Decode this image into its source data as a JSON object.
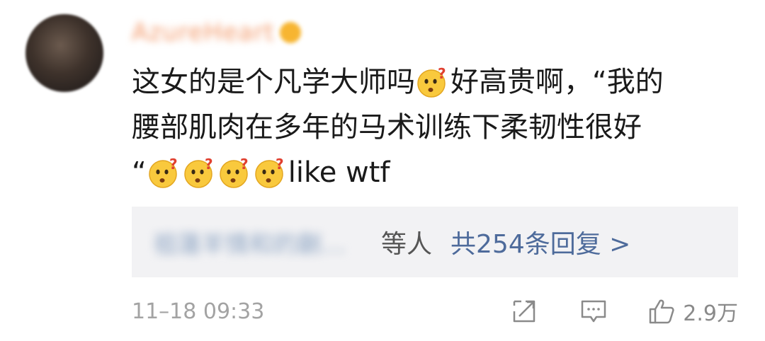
{
  "comment": {
    "username": "AzureHeart",
    "body_lines": [
      [
        "这女的是个凡学大师吗",
        "emoji",
        "好高贵啊，“我的"
      ],
      [
        "腰部肌肉在多年的马术训练下柔韧性很好"
      ],
      [
        "“",
        "emoji",
        "emoji",
        "emoji",
        "emoji",
        "like wtf"
      ]
    ],
    "emoji_icon": "confused-face-emoji-icon"
  },
  "replies": {
    "blurred_names": "祖蓮羊情和的蒯…",
    "others_text": "等人",
    "count_text": "共254条回复 >"
  },
  "footer": {
    "timestamp": "11–18 09:33",
    "share_icon": "share-icon",
    "comment_icon": "comment-icon",
    "like_icon": "thumbs-up-icon",
    "like_count": "2.9万"
  },
  "colors": {
    "link": "#4e6b9b",
    "text": "#1a1a1a",
    "meta": "#a3a3a3",
    "reply_box_bg": "#f2f2f4"
  }
}
